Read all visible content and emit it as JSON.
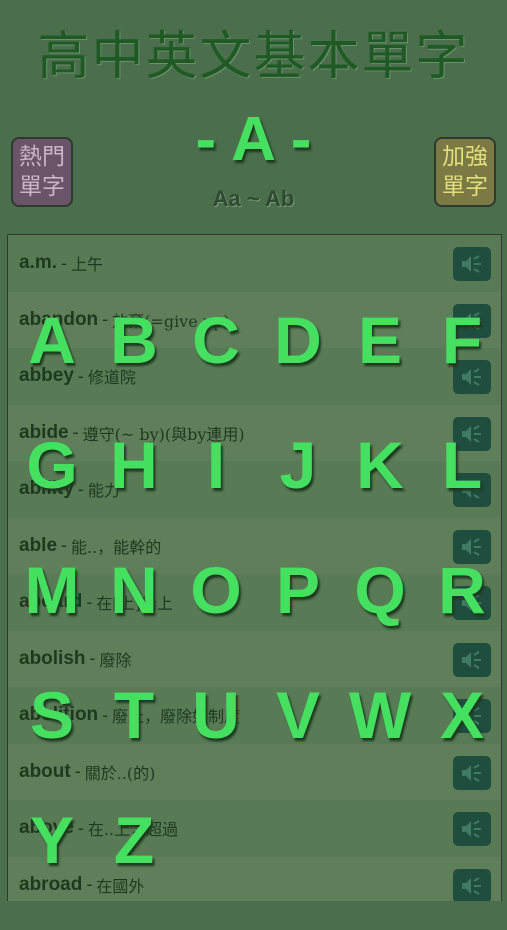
{
  "header": {
    "title": "高中英文基本單字",
    "left_button": [
      "熱門",
      "單字"
    ],
    "right_button": [
      "加強",
      "單字"
    ],
    "current_letter": "- A -",
    "current_range": "Aa ~ Ab"
  },
  "words": [
    {
      "word": "a.m.",
      "meaning": "上午"
    },
    {
      "word": "abandon",
      "meaning": "放棄(=give up)"
    },
    {
      "word": "abbey",
      "meaning": "修道院"
    },
    {
      "word": "abide",
      "meaning": "遵守(~ by)(與by連用)"
    },
    {
      "word": "ability",
      "meaning": "能力"
    },
    {
      "word": "able",
      "meaning": "能..，能幹的"
    },
    {
      "word": "aboard",
      "meaning": "在[上]船上"
    },
    {
      "word": "abolish",
      "meaning": "廢除"
    },
    {
      "word": "abolition",
      "meaning": "廢止，廢除奴制度"
    },
    {
      "word": "about",
      "meaning": "關於..(的)"
    },
    {
      "word": "above",
      "meaning": "在..上，超過"
    },
    {
      "word": "abroad",
      "meaning": "在國外"
    }
  ],
  "letters": [
    "A",
    "B",
    "C",
    "D",
    "E",
    "F",
    "G",
    "H",
    "I",
    "J",
    "K",
    "L",
    "M",
    "N",
    "O",
    "P",
    "Q",
    "R",
    "S",
    "T",
    "U",
    "V",
    "W",
    "X",
    "Y",
    "Z"
  ],
  "colors": {
    "background": "#4b6e4d",
    "title": "#1f5a25",
    "letter": "#46e060",
    "speaker_bg": "#1f4d3e"
  },
  "icons": {
    "speaker": "speaker-icon"
  }
}
